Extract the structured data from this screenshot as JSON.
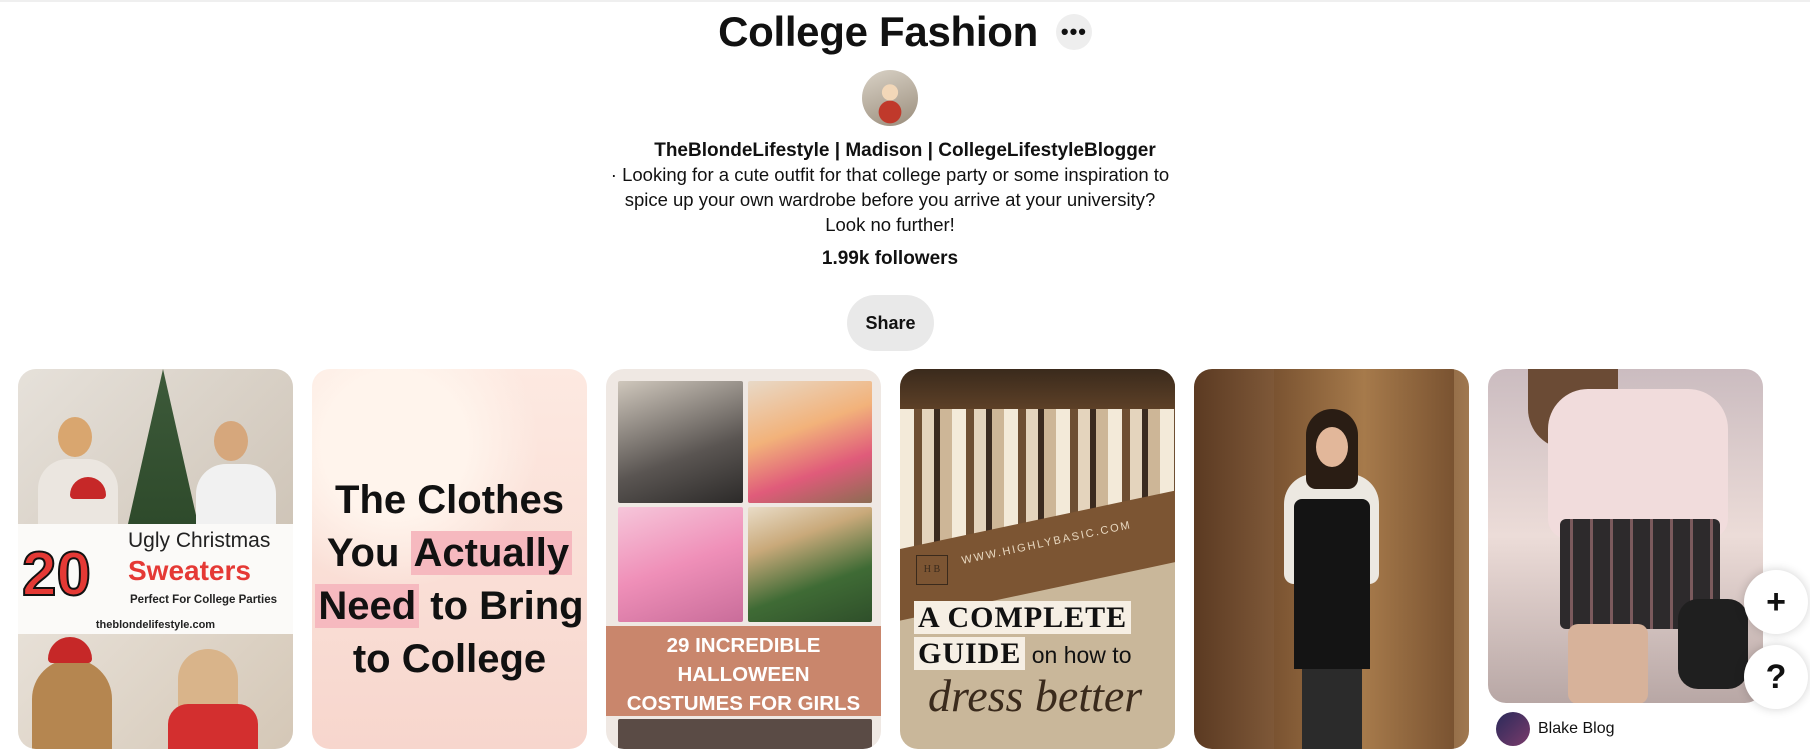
{
  "board": {
    "title": "College Fashion",
    "more_label": "•••",
    "owner": "TheBlondeLifestyle | Madison | CollegeLifestyleBlogger",
    "description": "· Looking for a cute outfit for that college party or some inspiration to spice up your own wardrobe before you arrive at your university? Look no further!",
    "followers": "1.99k followers",
    "share_label": "Share"
  },
  "pins": [
    {
      "number": "20",
      "line1": "Ugly Christmas",
      "line2": "Sweaters",
      "line3": "Perfect For College Parties",
      "site": "theblondelifestyle.com"
    },
    {
      "l1": "The Clothes",
      "l2a": "You ",
      "l2b": "Actually",
      "l3a": "Need",
      "l3b": " to Bring",
      "l4": "to College"
    },
    {
      "l1": "29 INCREDIBLE",
      "l2": "HALLOWEEN",
      "l3": "COSTUMES FOR GIRLS"
    },
    {
      "url": "WWW.HIGHLYBASIC.COM",
      "logo": "H B",
      "l1": "A COMPLETE",
      "l2a": "GUIDE",
      "l2b": " on how to",
      "l3": "dress better"
    },
    {},
    {
      "author": "Blake Blog"
    }
  ],
  "fab": {
    "plus": "+",
    "help": "?"
  },
  "colors": {
    "accent_red": "#e53935",
    "highlight_pink": "#f6b9bf",
    "halloween_band": "#c9866c"
  },
  "icons": {
    "more": "more-icon",
    "plus": "plus-icon",
    "help": "help-icon"
  }
}
